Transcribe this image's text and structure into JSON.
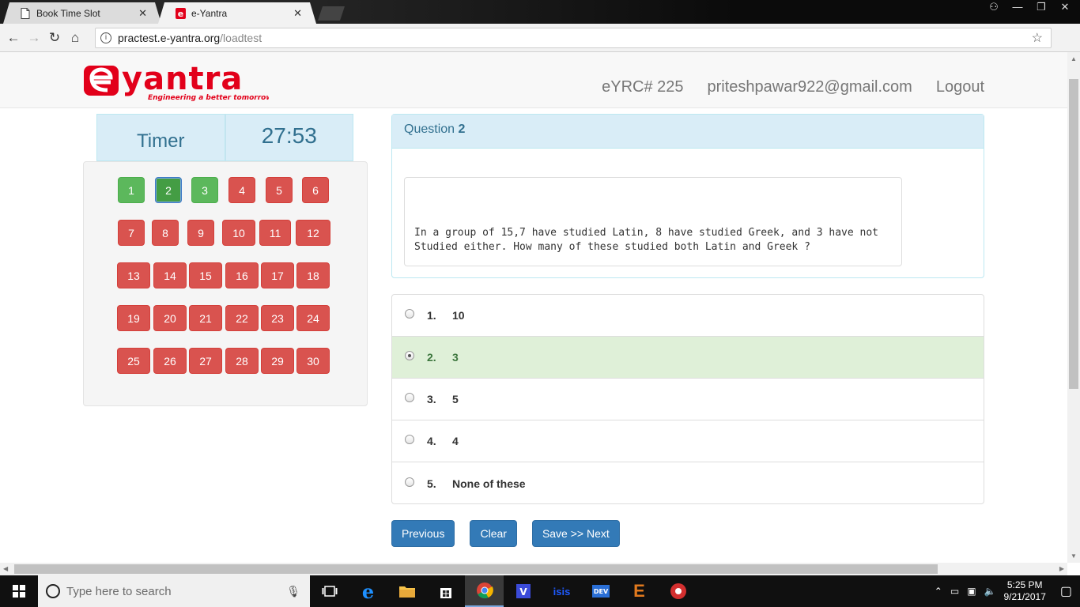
{
  "browser": {
    "tabs": [
      {
        "title": "Book Time Slot",
        "active": false
      },
      {
        "title": "e-Yantra",
        "active": true
      }
    ],
    "url_host": "practest.e-yantra.org",
    "url_path": "/loadtest"
  },
  "header": {
    "logo_text": "e yantra",
    "logo_tagline": "Engineering a better tomorrow",
    "team": "eYRC# 225",
    "email": "priteshpawar922@gmail.com",
    "logout": "Logout"
  },
  "timer": {
    "label": "Timer",
    "value": "27:53"
  },
  "questions_panel": {
    "buttons": [
      {
        "label": "1",
        "status": "answered"
      },
      {
        "label": "2",
        "status": "current"
      },
      {
        "label": "3",
        "status": "answered"
      },
      {
        "label": "4",
        "status": "unanswered"
      },
      {
        "label": "5",
        "status": "unanswered"
      },
      {
        "label": "6",
        "status": "unanswered"
      },
      {
        "label": "7",
        "status": "unanswered"
      },
      {
        "label": "8",
        "status": "unanswered"
      },
      {
        "label": "9",
        "status": "unanswered"
      },
      {
        "label": "10",
        "status": "unanswered"
      },
      {
        "label": "11",
        "status": "unanswered"
      },
      {
        "label": "12",
        "status": "unanswered"
      },
      {
        "label": "13",
        "status": "unanswered"
      },
      {
        "label": "14",
        "status": "unanswered"
      },
      {
        "label": "15",
        "status": "unanswered"
      },
      {
        "label": "16",
        "status": "unanswered"
      },
      {
        "label": "17",
        "status": "unanswered"
      },
      {
        "label": "18",
        "status": "unanswered"
      },
      {
        "label": "19",
        "status": "unanswered"
      },
      {
        "label": "20",
        "status": "unanswered"
      },
      {
        "label": "21",
        "status": "unanswered"
      },
      {
        "label": "22",
        "status": "unanswered"
      },
      {
        "label": "23",
        "status": "unanswered"
      },
      {
        "label": "24",
        "status": "unanswered"
      },
      {
        "label": "25",
        "status": "unanswered"
      },
      {
        "label": "26",
        "status": "unanswered"
      },
      {
        "label": "27",
        "status": "unanswered"
      },
      {
        "label": "28",
        "status": "unanswered"
      },
      {
        "label": "29",
        "status": "unanswered"
      },
      {
        "label": "30",
        "status": "unanswered"
      }
    ]
  },
  "question": {
    "heading": "Question",
    "number": "2",
    "text_line1": "In a group of 15,7 have studied Latin, 8 have studied Greek, and 3 have not",
    "text_line2": "Studied either. How many of these studied both Latin and Greek ?"
  },
  "options": [
    {
      "num": "1.",
      "text": "10",
      "selected": false
    },
    {
      "num": "2.",
      "text": "3",
      "selected": true
    },
    {
      "num": "3.",
      "text": "5",
      "selected": false
    },
    {
      "num": "4.",
      "text": "4",
      "selected": false
    },
    {
      "num": "5.",
      "text": "None of these",
      "selected": false
    }
  ],
  "actions": {
    "previous": "Previous",
    "clear": "Clear",
    "save_next": "Save >> Next"
  },
  "taskbar": {
    "search_placeholder": "Type here to search",
    "time": "5:25 PM",
    "date": "9/21/2017"
  },
  "colors": {
    "unanswered": "#d9534f",
    "answered": "#5cb85c",
    "primary": "#337ab7",
    "info_bg": "#d9edf7"
  }
}
